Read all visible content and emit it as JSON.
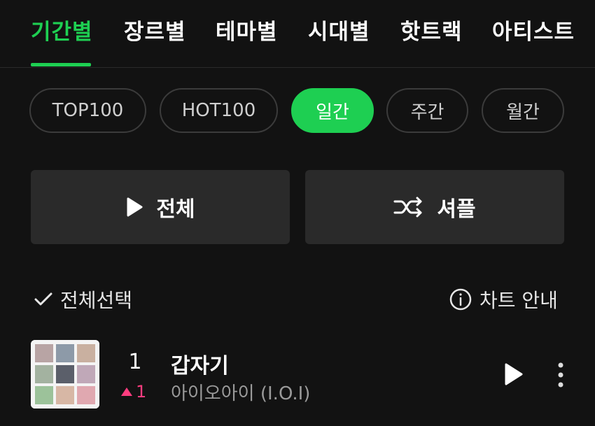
{
  "nav": {
    "tabs": [
      {
        "label": "기간별",
        "active": true
      },
      {
        "label": "장르별",
        "active": false
      },
      {
        "label": "테마별",
        "active": false
      },
      {
        "label": "시대별",
        "active": false
      },
      {
        "label": "핫트랙",
        "active": false
      },
      {
        "label": "아티스트",
        "active": false
      }
    ]
  },
  "filters": [
    {
      "label": "TOP100",
      "active": false
    },
    {
      "label": "HOT100",
      "active": false
    },
    {
      "label": "일간",
      "active": true
    },
    {
      "label": "주간",
      "active": false
    },
    {
      "label": "월간",
      "active": false
    }
  ],
  "actions": {
    "play_all": "전체",
    "shuffle": "셔플"
  },
  "list_controls": {
    "select_all": "전체선택",
    "chart_info": "차트 안내"
  },
  "songs": [
    {
      "rank": "1",
      "change": "1",
      "change_dir": "up",
      "title": "갑자기",
      "artist": "아이오아이 (I.O.I)"
    }
  ],
  "colors": {
    "accent": "#1ecf52",
    "background": "#121212",
    "rank_up": "#ff3d7f"
  },
  "icons": {
    "play": "play-icon",
    "shuffle": "shuffle-icon",
    "check": "check-icon",
    "info": "info-icon",
    "more": "more-vertical-icon"
  }
}
